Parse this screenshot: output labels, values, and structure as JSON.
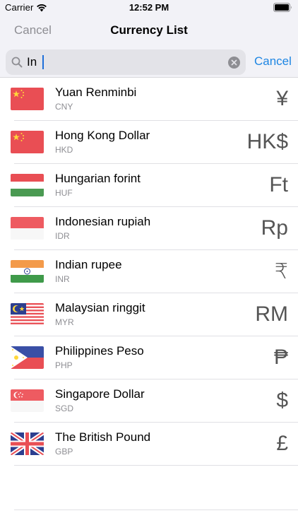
{
  "status_bar": {
    "carrier": "Carrier",
    "time": "12:52 PM",
    "wifi_icon": "wifi-icon",
    "battery_icon": "battery-icon"
  },
  "nav": {
    "cancel_label": "Cancel",
    "title": "Currency List"
  },
  "search": {
    "value": "In",
    "search_icon": "search-icon",
    "clear_icon": "clear-icon",
    "cancel_label": "Cancel"
  },
  "colors": {
    "accent": "#1e86e3",
    "muted": "#8e8e93",
    "bar_background": "#f2f2f7"
  },
  "currencies": [
    {
      "name": "Yuan Renminbi",
      "code": "CNY",
      "symbol": "¥",
      "flag": "china-flag-icon"
    },
    {
      "name": "Hong Kong Dollar",
      "code": "HKD",
      "symbol": "HK$",
      "flag": "china-flag-icon"
    },
    {
      "name": "Hungarian forint",
      "code": "HUF",
      "symbol": "Ft",
      "flag": "hungary-flag-icon"
    },
    {
      "name": "Indonesian rupiah",
      "code": "IDR",
      "symbol": "Rp",
      "flag": "indonesia-flag-icon"
    },
    {
      "name": "Indian rupee",
      "code": "INR",
      "symbol": "₹",
      "flag": "india-flag-icon"
    },
    {
      "name": "Malaysian ringgit",
      "code": "MYR",
      "symbol": "RM",
      "flag": "malaysia-flag-icon"
    },
    {
      "name": "Philippines Peso",
      "code": "PHP",
      "symbol": "₱",
      "flag": "philippines-flag-icon"
    },
    {
      "name": "Singapore Dollar",
      "code": "SGD",
      "symbol": "$",
      "flag": "singapore-flag-icon"
    },
    {
      "name": "The British Pound",
      "code": "GBP",
      "symbol": "£",
      "flag": "uk-flag-icon"
    }
  ]
}
